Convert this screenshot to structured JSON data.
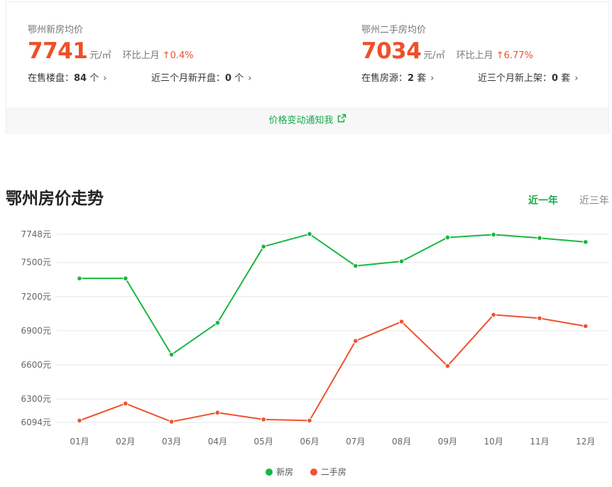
{
  "summary": {
    "new": {
      "title": "鄂州新房均价",
      "price": "7741",
      "unit": "元/㎡",
      "mom_label": "环比上月",
      "mom_arrow": "↑",
      "mom_value": "0.4%",
      "stat1_label": "在售楼盘：",
      "stat1_value": "84",
      "stat1_unit": " 个",
      "stat2_label": "近三个月新开盘：",
      "stat2_value": "0",
      "stat2_unit": " 个"
    },
    "second": {
      "title": "鄂州二手房均价",
      "price": "7034",
      "unit": "元/㎡",
      "mom_label": "环比上月",
      "mom_arrow": "↑",
      "mom_value": "6.77%",
      "stat1_label": "在售房源：",
      "stat1_value": "2",
      "stat1_unit": " 套",
      "stat2_label": "近三个月新上架：",
      "stat2_value": "0",
      "stat2_unit": " 套"
    },
    "notify_label": "价格变动通知我"
  },
  "trend": {
    "title": "鄂州房价走势",
    "tabs": {
      "active": "近一年",
      "inactive": "近三年"
    }
  },
  "colors": {
    "green": "#17b83f",
    "red": "#ee5231",
    "accent_text": "#17a84a"
  },
  "chart_data": {
    "type": "line",
    "categories": [
      "01月",
      "02月",
      "03月",
      "04月",
      "05月",
      "06月",
      "07月",
      "08月",
      "09月",
      "10月",
      "11月",
      "12月"
    ],
    "series": [
      {
        "name": "新房",
        "color": "#17b83f",
        "values": [
          7360,
          7360,
          6690,
          6970,
          7640,
          7750,
          7470,
          7510,
          7720,
          7745,
          7715,
          7680
        ]
      },
      {
        "name": "二手房",
        "color": "#ee5231",
        "values": [
          6110,
          6260,
          6100,
          6180,
          6120,
          6110,
          6810,
          6980,
          6590,
          7040,
          7010,
          6940
        ]
      }
    ],
    "yticks": [
      6094,
      6300,
      6600,
      6900,
      7200,
      7500,
      7748
    ],
    "ytick_labels": [
      "6094元",
      "6300元",
      "6600元",
      "6900元",
      "7200元",
      "7500元",
      "7748元"
    ],
    "ylim": [
      6094,
      7748
    ],
    "grid": true,
    "legend_position": "bottom"
  }
}
